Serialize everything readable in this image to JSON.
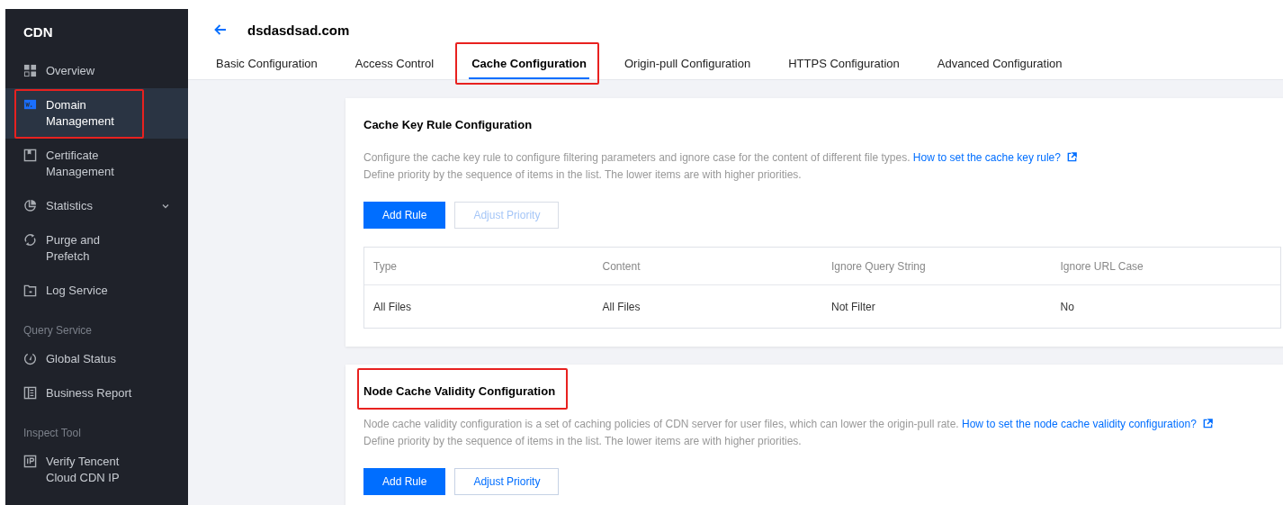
{
  "sidebar": {
    "title": "CDN",
    "items": [
      {
        "kind": "item",
        "label": "Overview",
        "selected": false,
        "highlighted": false,
        "expandable": false
      },
      {
        "kind": "item",
        "label": "Domain Management",
        "selected": true,
        "highlighted": true,
        "expandable": false
      },
      {
        "kind": "item",
        "label": "Certificate Management",
        "selected": false,
        "highlighted": false,
        "expandable": false
      },
      {
        "kind": "item",
        "label": "Statistics",
        "selected": false,
        "highlighted": false,
        "expandable": true
      },
      {
        "kind": "item",
        "label": "Purge and Prefetch",
        "selected": false,
        "highlighted": false,
        "expandable": false
      },
      {
        "kind": "item",
        "label": "Log Service",
        "selected": false,
        "highlighted": false,
        "expandable": false
      },
      {
        "kind": "section",
        "label": "Query Service"
      },
      {
        "kind": "item",
        "label": "Global Status",
        "selected": false,
        "highlighted": false,
        "expandable": false
      },
      {
        "kind": "item",
        "label": "Business Report",
        "selected": false,
        "highlighted": false,
        "expandable": false
      },
      {
        "kind": "section",
        "label": "Inspect Tool"
      },
      {
        "kind": "item",
        "label": "Verify Tencent Cloud CDN IP",
        "selected": false,
        "highlighted": false,
        "expandable": false
      }
    ]
  },
  "header": {
    "title": "dsdasdsad.com"
  },
  "tabs": [
    {
      "label": "Basic Configuration",
      "selected": false,
      "highlighted": false
    },
    {
      "label": "Access Control",
      "selected": false,
      "highlighted": false
    },
    {
      "label": "Cache Configuration",
      "selected": true,
      "highlighted": true
    },
    {
      "label": "Origin-pull Configuration",
      "selected": false,
      "highlighted": false
    },
    {
      "label": "HTTPS Configuration",
      "selected": false,
      "highlighted": false
    },
    {
      "label": "Advanced Configuration",
      "selected": false,
      "highlighted": false
    }
  ],
  "cards": [
    {
      "title": "Cache Key Rule Configuration",
      "title_highlighted": false,
      "description": "Configure the cache key rule to configure filtering parameters and ignore case for the content of different file types.",
      "link": "How to set the cache key rule?",
      "note": "Define priority by the sequence of items in the list. The lower items are with higher priorities.",
      "buttons": [
        {
          "label": "Add Rule",
          "kind": "primary",
          "disabled": false
        },
        {
          "label": "Adjust Priority",
          "kind": "secondary",
          "disabled": true
        }
      ],
      "table": {
        "columns": [
          "Type",
          "Content",
          "Ignore Query String",
          "Ignore URL Case"
        ],
        "rows": [
          [
            "All Files",
            "All Files",
            "Not Filter",
            "No"
          ]
        ]
      }
    },
    {
      "title": "Node Cache Validity Configuration",
      "title_highlighted": true,
      "description": "Node cache validity configuration is a set of caching policies of CDN server for user files, which can lower the origin-pull rate.",
      "link": "How to set the node cache validity configuration?",
      "note": "Define priority by the sequence of items in the list. The lower items are with higher priorities.",
      "buttons": [
        {
          "label": "Add Rule",
          "kind": "primary",
          "disabled": false
        },
        {
          "label": "Adjust Priority",
          "kind": "secondary",
          "disabled": false
        }
      ]
    }
  ]
}
